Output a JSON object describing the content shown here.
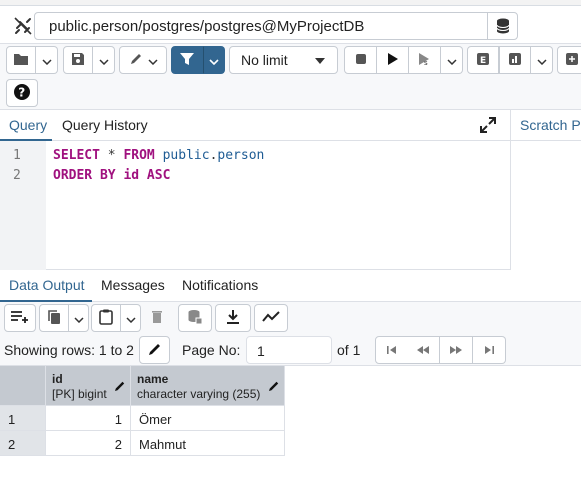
{
  "connection": {
    "label": "public.person/postgres/postgres@MyProjectDB"
  },
  "toolbar": {
    "limit_value": "No limit",
    "icons": [
      "open-file-icon",
      "chevron-down-icon",
      "save-icon",
      "chevron-down-icon",
      "edit-icon",
      "chevron-down-icon",
      "filter-icon",
      "chevron-down-icon",
      "stop-icon",
      "execute-icon",
      "explain-icon",
      "chevron-down-icon",
      "explain-e-icon",
      "explain-analyze-icon",
      "chevron-down-icon",
      "commit-icon",
      "help-icon"
    ]
  },
  "editor": {
    "tabs": [
      "Query",
      "Query History"
    ],
    "scratch_tab": "Scratch P",
    "lines": [
      {
        "num": "1",
        "parts": [
          [
            "SELECT",
            "kw"
          ],
          [
            " * ",
            "op"
          ],
          [
            "FROM",
            "kw"
          ],
          [
            " public",
            "ident"
          ],
          [
            ".",
            "op"
          ],
          [
            "person",
            "ident"
          ]
        ]
      },
      {
        "num": "2",
        "parts": [
          [
            "ORDER BY id ASC",
            "plain"
          ]
        ]
      }
    ]
  },
  "output": {
    "tabs": [
      "Data Output",
      "Messages",
      "Notifications"
    ]
  },
  "pager": {
    "showing": "Showing rows: 1 to 2",
    "page_no_label": "Page No:",
    "page_value": "1",
    "of_label": "of 1"
  },
  "grid": {
    "columns": [
      {
        "name": "id",
        "type": "[PK] bigint"
      },
      {
        "name": "name",
        "type": "character varying (255)"
      }
    ],
    "rows": [
      {
        "num": "1",
        "id": "1",
        "name": "Ömer"
      },
      {
        "num": "2",
        "id": "2",
        "name": "Mahmut"
      }
    ]
  }
}
